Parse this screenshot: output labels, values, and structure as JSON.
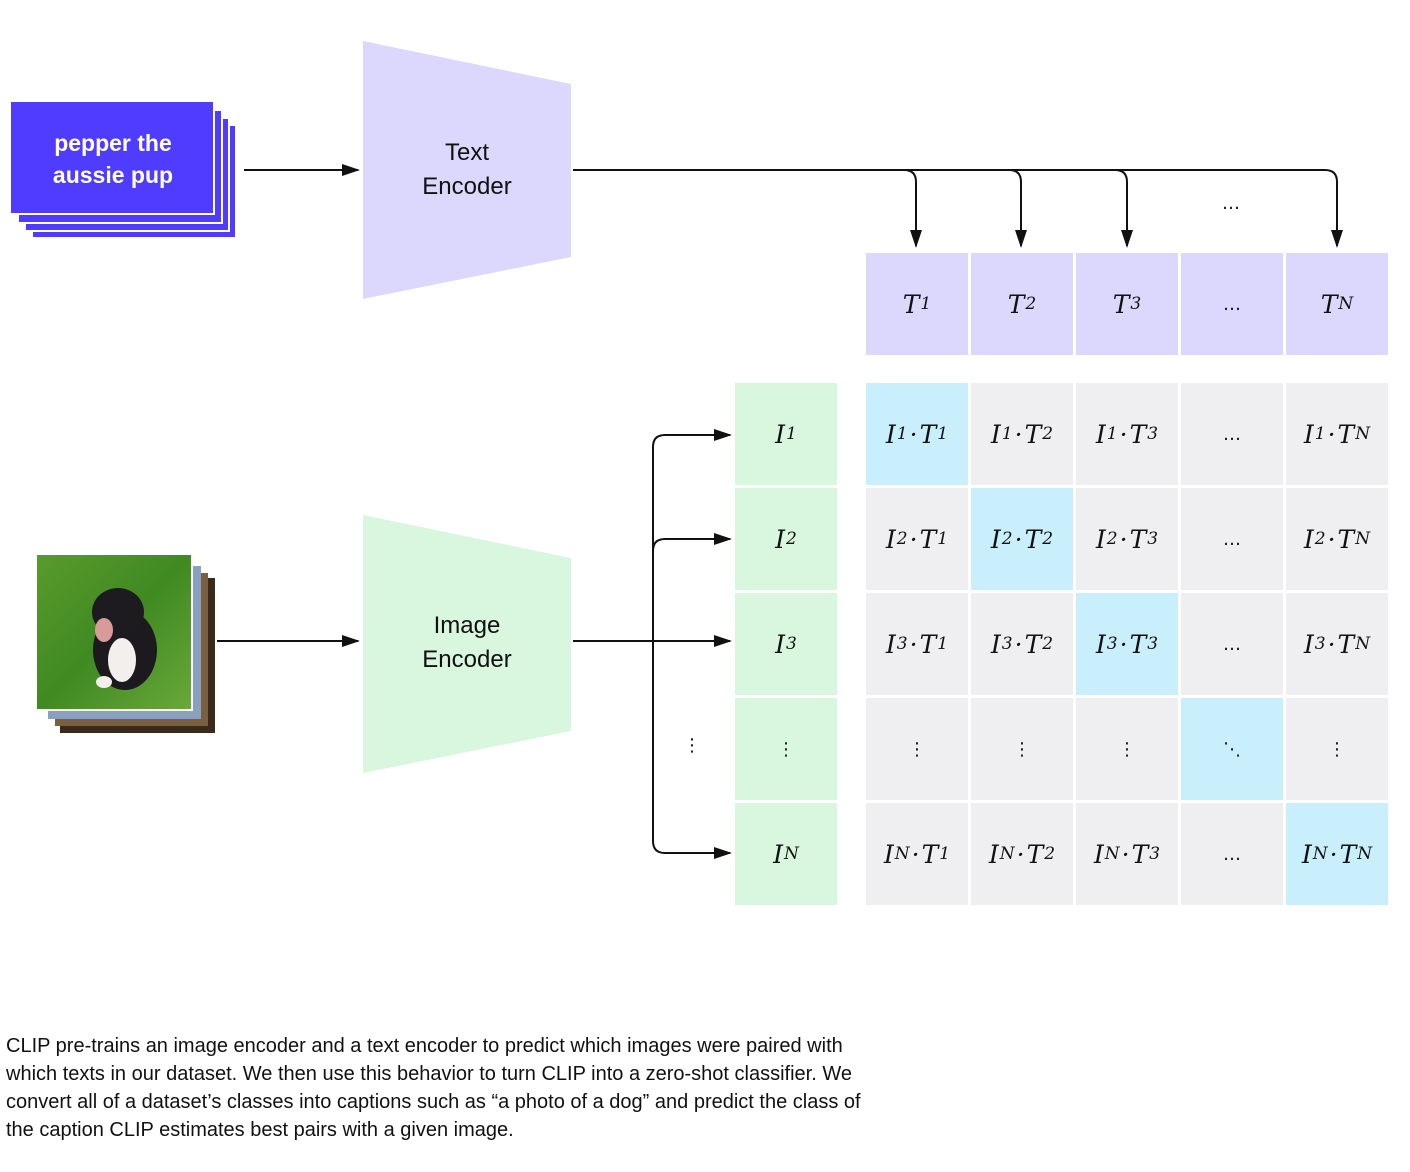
{
  "text_input": {
    "line1": "pepper the",
    "line2": "aussie pup"
  },
  "text_encoder": {
    "line1": "Text",
    "line2": "Encoder"
  },
  "image_encoder": {
    "line1": "Image",
    "line2": "Encoder"
  },
  "image_input": {
    "icon": "dog-photo-stack"
  },
  "text_embeddings": {
    "symbol": "T",
    "subscripts": [
      "1",
      "2",
      "3",
      "…",
      "N"
    ]
  },
  "image_embeddings": {
    "symbol": "I",
    "subscripts": [
      "1",
      "2",
      "3",
      "⋮",
      "N"
    ]
  },
  "ellipsis_above_columns": "…",
  "ellipsis_left_of_rows": "⋮",
  "diagonal_ellipsis": "⋱",
  "colors": {
    "text_input": "#4f3cff",
    "text_side": "#dcd7fd",
    "image_side": "#d9f6df",
    "matrix_cell": "#efeff1",
    "matrix_diagonal": "#c9eefc"
  },
  "caption": "CLIP pre-trains an image encoder and a text encoder to predict which images were paired with which texts in our dataset. We then use this behavior to turn CLIP into a zero-shot classifier. We convert all of a dataset’s classes into captions such as “a photo of a dog” and predict the class of the caption CLIP estimates best pairs with a given image."
}
